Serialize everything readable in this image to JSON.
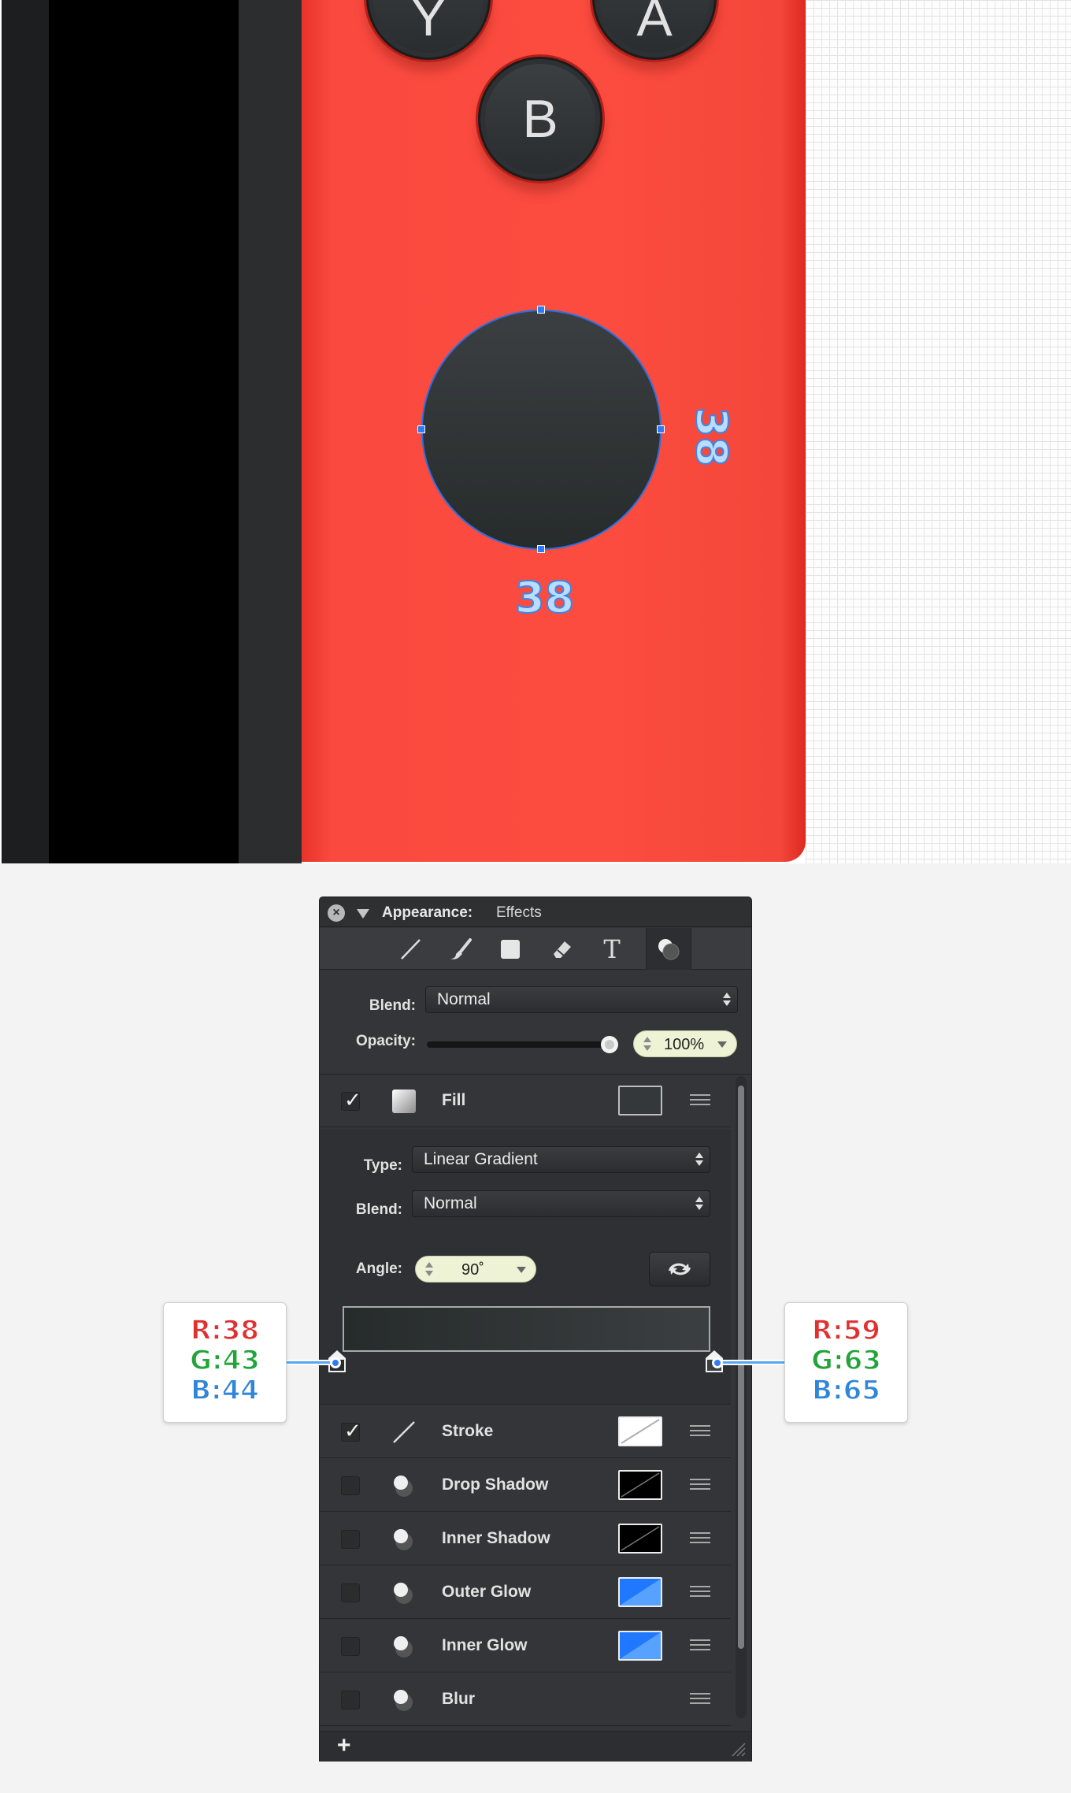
{
  "canvas": {
    "buttons": {
      "y_label": "Y",
      "a_label": "A",
      "b_label": "B"
    },
    "dimensions": {
      "width_label": "38",
      "height_label": "38"
    },
    "colors": {
      "controller_red": "#fc4c40",
      "button_dark": "#2e3133",
      "selection_blue": "#2f7bf5"
    }
  },
  "panel": {
    "title_label": "Appearance:",
    "title_value": "Effects",
    "tabs": [
      {
        "name": "stroke-tool-icon"
      },
      {
        "name": "brush-icon"
      },
      {
        "name": "fill-square-icon"
      },
      {
        "name": "eraser-icon"
      },
      {
        "name": "text-icon"
      },
      {
        "name": "effects-icon"
      }
    ],
    "blend": {
      "label": "Blend:",
      "value": "Normal"
    },
    "opacity": {
      "label": "Opacity:",
      "value": "100%",
      "level": 1.0
    },
    "fill": {
      "label": "Fill",
      "checked": true,
      "type": {
        "label": "Type:",
        "value": "Linear Gradient"
      },
      "blend": {
        "label": "Blend:",
        "value": "Normal"
      },
      "angle": {
        "label": "Angle:",
        "value": "90˚"
      },
      "gradient_start": "#262b2c",
      "gradient_end": "#3b3f41"
    },
    "effects": [
      {
        "label": "Stroke",
        "checked": true
      },
      {
        "label": "Drop Shadow",
        "checked": false
      },
      {
        "label": "Inner Shadow",
        "checked": false
      },
      {
        "label": "Outer Glow",
        "checked": false
      },
      {
        "label": "Inner Glow",
        "checked": false
      },
      {
        "label": "Blur",
        "checked": false
      }
    ],
    "add_label": "+"
  },
  "callouts": {
    "left": {
      "r": "R:38",
      "g": "G:43",
      "b": "B:44"
    },
    "right": {
      "r": "R:59",
      "g": "G:63",
      "b": "B:65"
    }
  }
}
